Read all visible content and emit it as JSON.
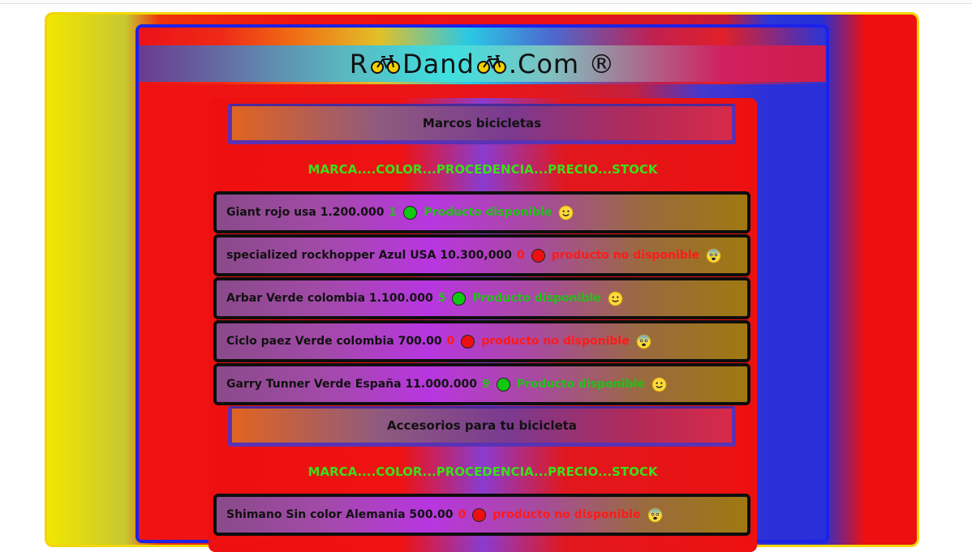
{
  "site": {
    "title_parts": [
      "R",
      "Dand",
      ".Com ®"
    ],
    "bike_icon": "bicycle-icon"
  },
  "sections": [
    {
      "title": "Marcos bicicletas",
      "columns": "MARCA....COLOR...PROCEDENCIA...PRECIO...STOCK",
      "items": [
        {
          "text": "Giant rojo usa 1.200.000",
          "stock": "1",
          "available": true,
          "status": "Producto disponible"
        },
        {
          "text": "specialized rockhopper Azul USA 10.300,000",
          "stock": "0",
          "available": false,
          "status": "producto no disponible"
        },
        {
          "text": "Arbar Verde colombia 1.100.000",
          "stock": "5",
          "available": true,
          "status": "Producto disponible"
        },
        {
          "text": "Ciclo paez Verde colombia 700.00",
          "stock": "0",
          "available": false,
          "status": "producto no disponible"
        },
        {
          "text": "Garry Tunner Verde España 11.000.000",
          "stock": "9",
          "available": true,
          "status": "Producto disponible"
        }
      ]
    },
    {
      "title": "Accesorios para tu bicicleta",
      "columns": "MARCA....COLOR...PROCEDENCIA...PRECIO...STOCK",
      "items": [
        {
          "text": "Shimano Sin color Alemania 500.00",
          "stock": "0",
          "available": false,
          "status": "producto no disponible"
        }
      ]
    }
  ],
  "colors": {
    "available": "#22c018",
    "unavailable": "#ff1a1a",
    "dot_green": "#12c812",
    "dot_red": "#ee1010",
    "column_header": "#3ae018"
  }
}
